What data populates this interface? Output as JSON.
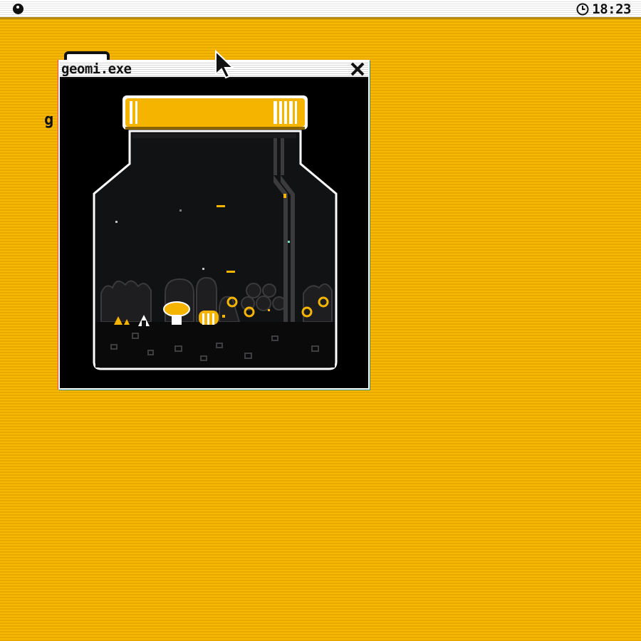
{
  "menubar": {
    "apple_icon": "system-menu-icon",
    "clock_icon": "clock-icon",
    "time": "18:23"
  },
  "desktop": {
    "icon_label": "g"
  },
  "window": {
    "title": "geomi.exe",
    "close_icon": "close-icon",
    "scene": "pixel-art terrarium jar with glowing fireflies, mushroom and plants"
  },
  "colors": {
    "desktop": "#f2b200",
    "accent": "#f5b400",
    "jar_outline": "#ffffff",
    "window_bg": "#000000"
  }
}
